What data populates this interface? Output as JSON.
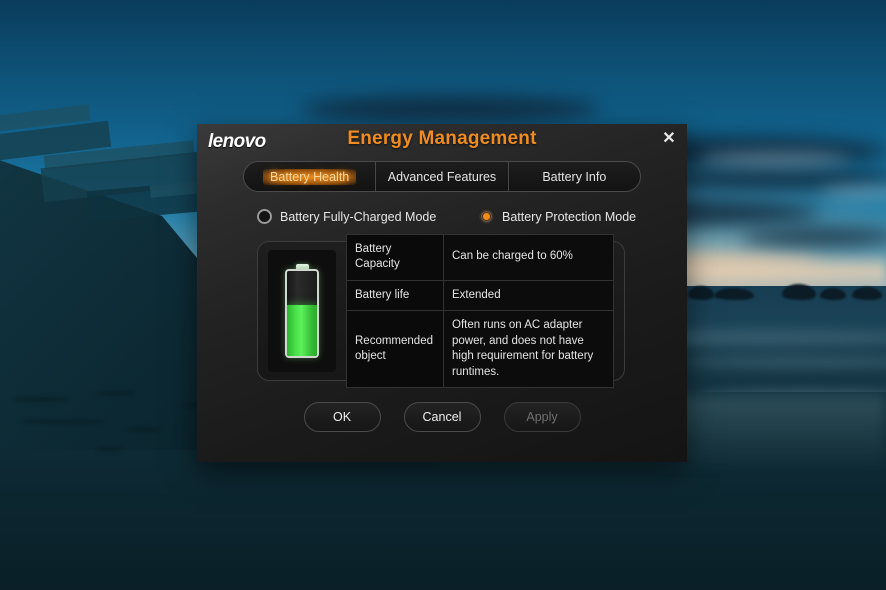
{
  "wallpaper": {
    "scene_name": "coastal-sunset-beach"
  },
  "dialog": {
    "logo": "lenovo",
    "title": "Energy Management",
    "close_label": "✕",
    "tabs": [
      {
        "label": "Battery Health",
        "active": true
      },
      {
        "label": "Advanced Features",
        "active": false
      },
      {
        "label": "Battery Info",
        "active": false
      }
    ],
    "modes": [
      {
        "label": "Battery Fully-Charged Mode",
        "selected": false
      },
      {
        "label": "Battery Protection Mode",
        "selected": true
      }
    ],
    "battery": {
      "fill_percent": 60,
      "fill_color": "#49e049"
    },
    "info_rows": [
      {
        "key": "Battery Capacity",
        "value": "Can be charged to 60%"
      },
      {
        "key": "Battery life",
        "value": "Extended"
      },
      {
        "key": "Recommended object",
        "value": "Often runs on AC adapter power, and does not have high requirement for battery runtimes."
      }
    ],
    "buttons": [
      {
        "label": "OK",
        "disabled": false
      },
      {
        "label": "Cancel",
        "disabled": false
      },
      {
        "label": "Apply",
        "disabled": true
      }
    ],
    "colors": {
      "accent_orange": "#ef8c1f",
      "battery_green": "#49e049",
      "dialog_bg": "#222222"
    }
  }
}
